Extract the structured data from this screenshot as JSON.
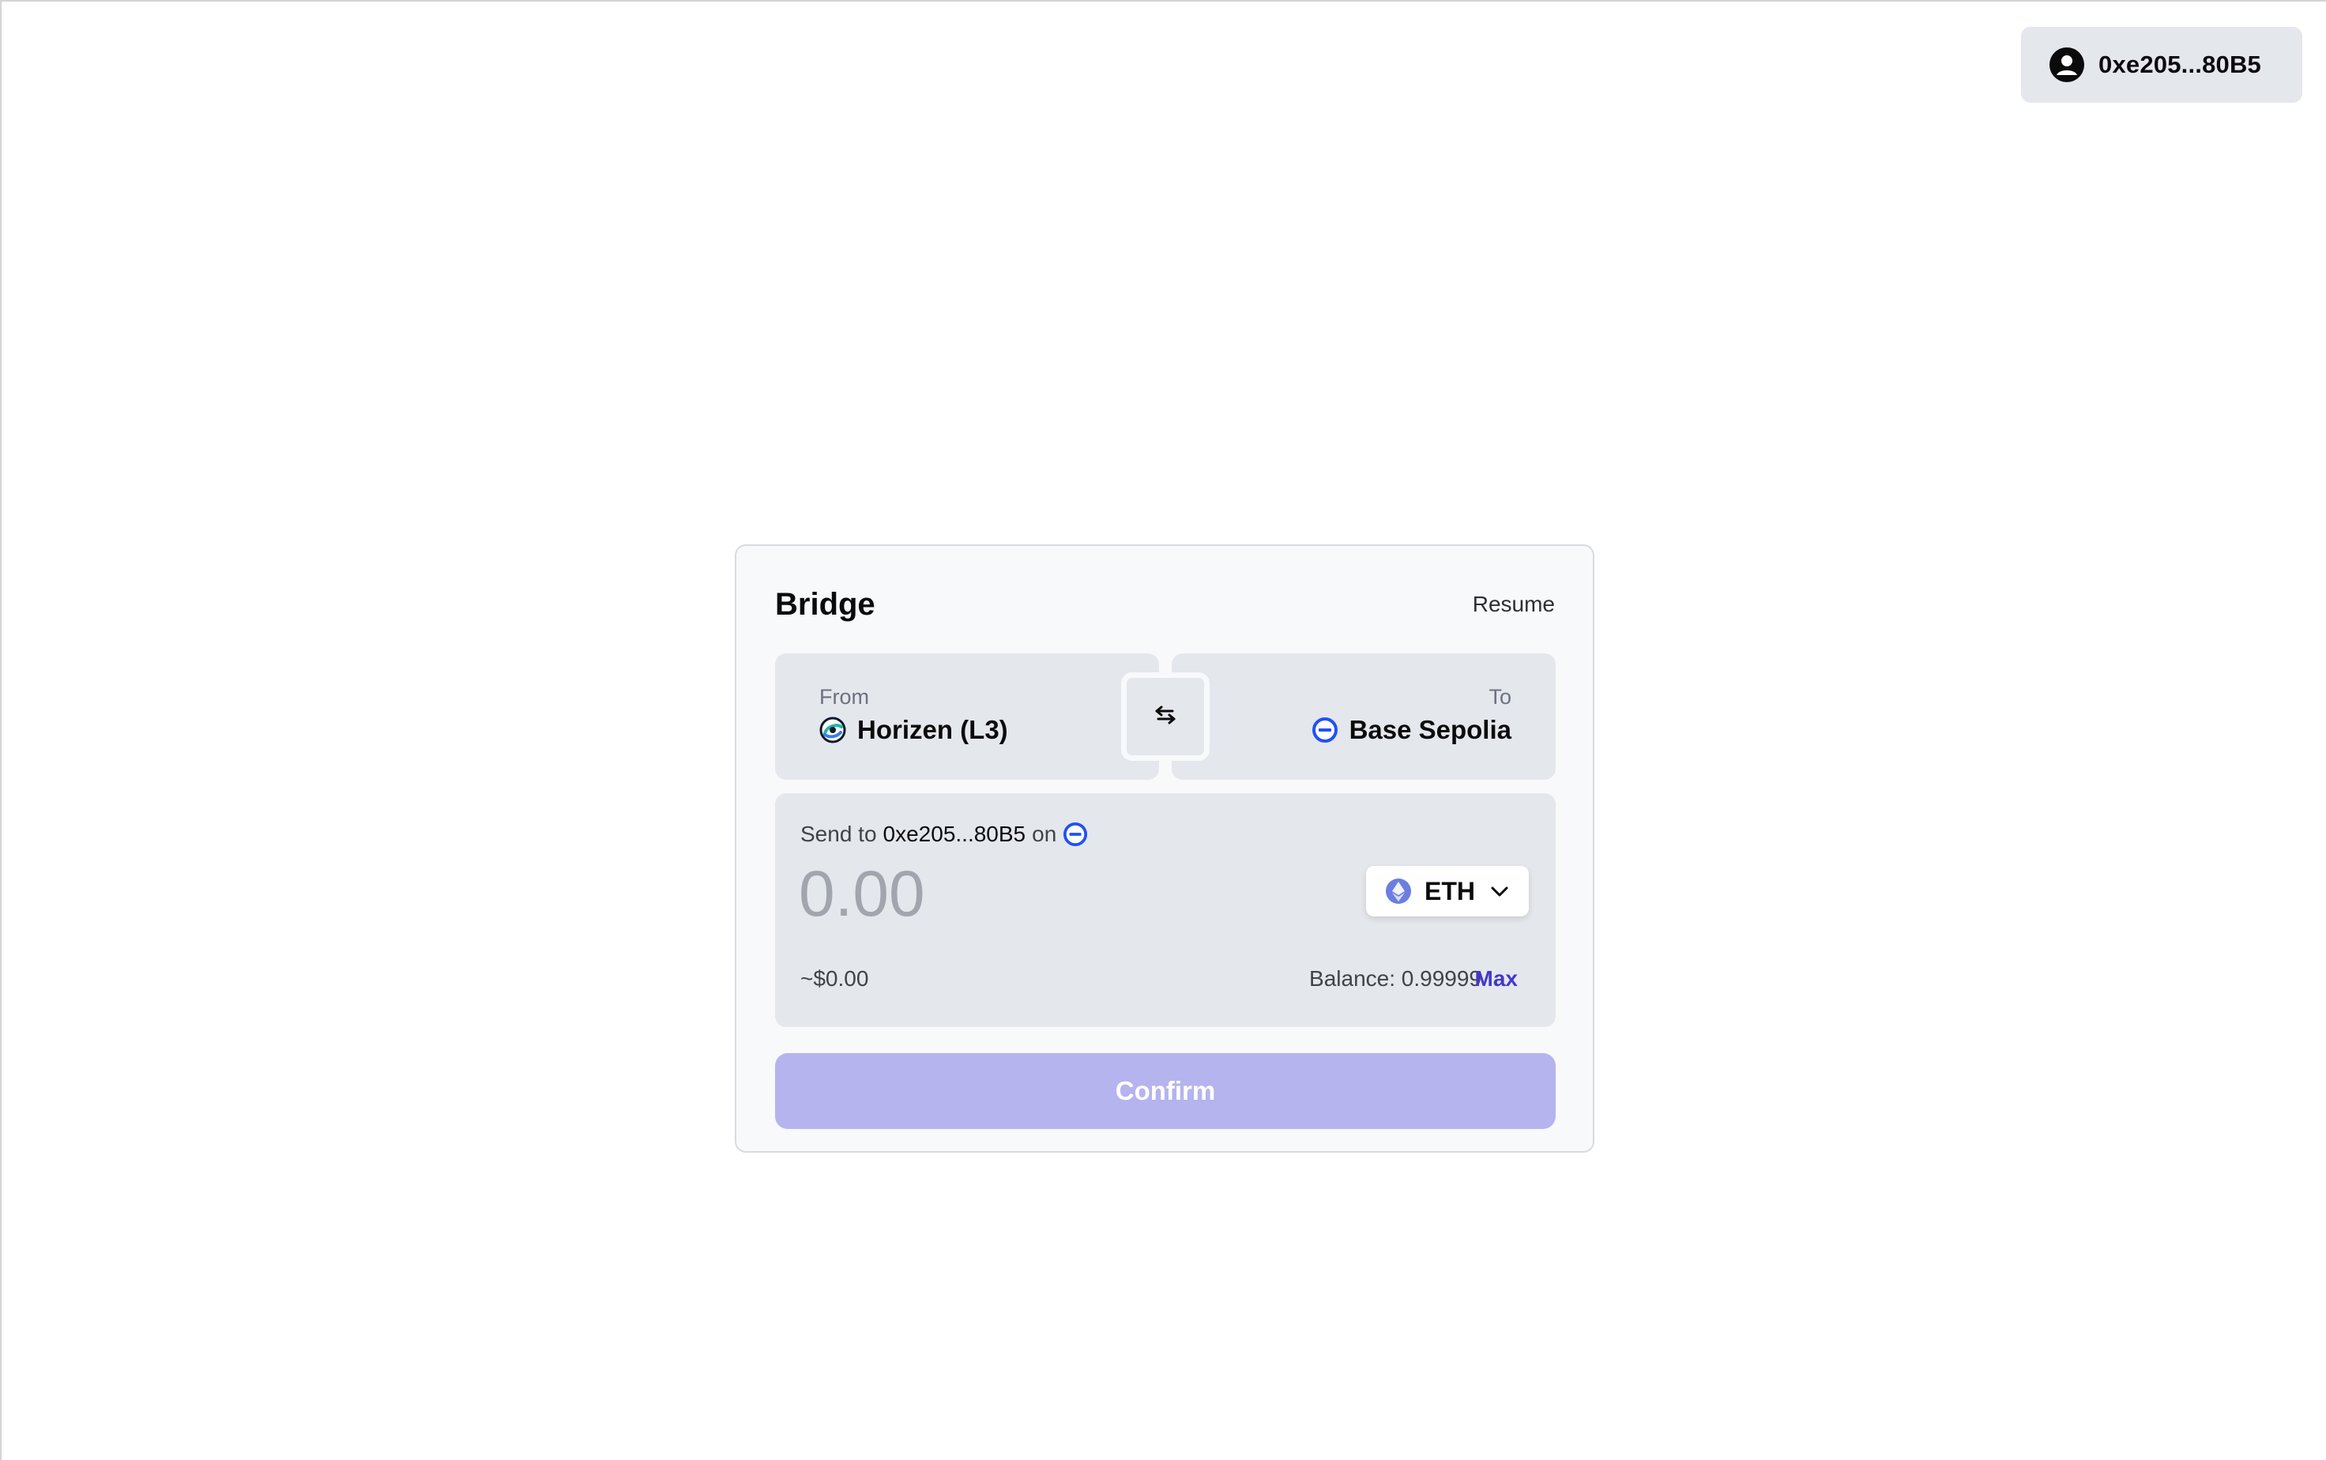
{
  "wallet": {
    "address": "0xe205...80B5",
    "icon": "user-avatar-icon"
  },
  "bridge": {
    "title": "Bridge",
    "resume_label": "Resume",
    "from": {
      "label": "From",
      "chain": "Horizen (L3)",
      "icon": "horizen-logo-icon"
    },
    "to": {
      "label": "To",
      "chain": "Base Sepolia",
      "icon": "base-logo-icon"
    },
    "swap_icon": "swap-arrows-icon",
    "send_to": {
      "prefix": "Send to",
      "address": "0xe205...80B5",
      "on": "on"
    },
    "amount": {
      "value": "",
      "placeholder": "0.00"
    },
    "token": {
      "symbol": "ETH",
      "icon": "eth-icon"
    },
    "usd_value": "~$0.00",
    "balance_label": "Balance: 0.99999",
    "max_label": "Max",
    "confirm_label": "Confirm"
  },
  "colors": {
    "accent": "#4338ca",
    "confirm_disabled": "#b5b4ee",
    "panel": "#e4e7ec",
    "base_blue": "#2151f5"
  }
}
